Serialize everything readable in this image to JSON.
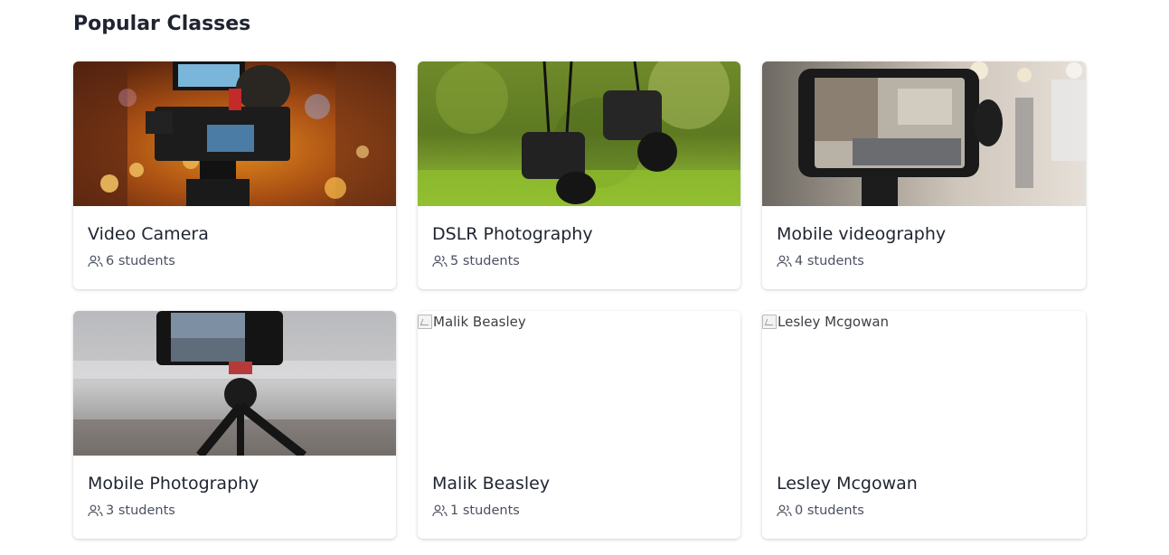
{
  "section": {
    "title": "Popular Classes"
  },
  "classes": [
    {
      "title": "Video Camera",
      "students": "6 students",
      "image": "video-camera-photo",
      "image_alt": ""
    },
    {
      "title": "DSLR Photography",
      "students": "5 students",
      "image": "dslr-cameras-photo",
      "image_alt": ""
    },
    {
      "title": "Mobile videography",
      "students": "4 students",
      "image": "phone-gimbal-photo",
      "image_alt": ""
    },
    {
      "title": "Mobile Photography",
      "students": "3 students",
      "image": "phone-tripod-photo",
      "image_alt": ""
    },
    {
      "title": "Malik Beasley",
      "students": "1 students",
      "image": "broken-image",
      "image_alt": "Malik Beasley"
    },
    {
      "title": "Lesley Mcgowan",
      "students": "0 students",
      "image": "broken-image",
      "image_alt": "Lesley Mcgowan"
    }
  ],
  "colors": {
    "title": "#1f2430",
    "meta": "#4b5160",
    "card_bg": "#ffffff"
  },
  "icons": {
    "students": "users-icon"
  }
}
